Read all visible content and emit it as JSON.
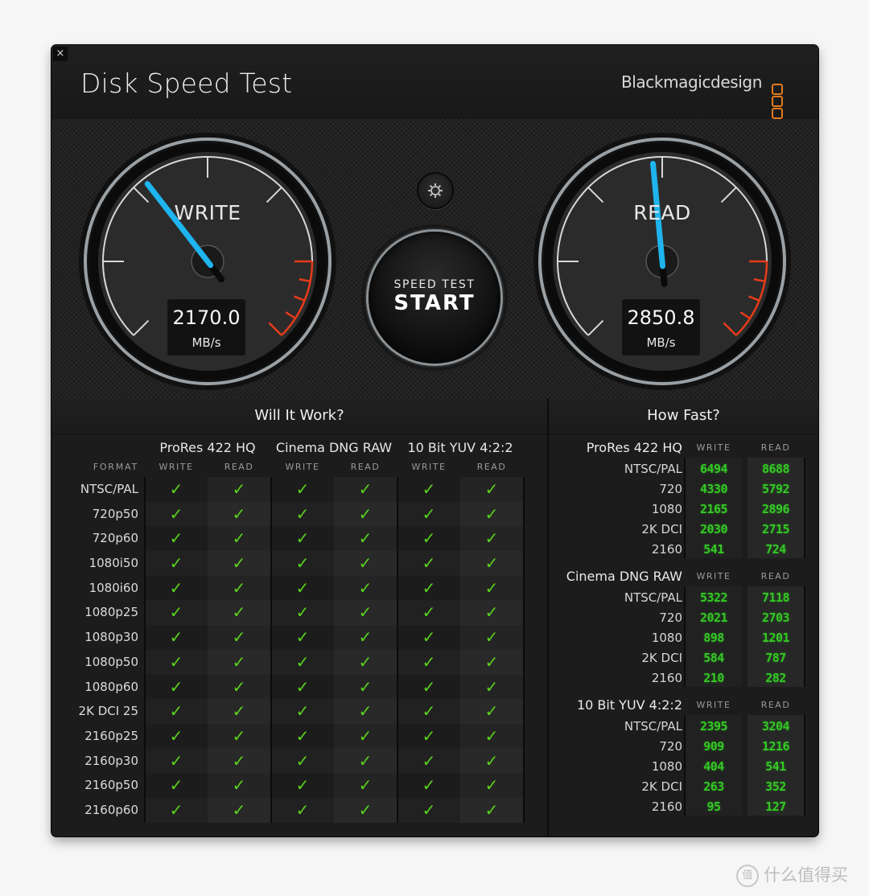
{
  "window": {
    "title": "Disk Speed Test",
    "brand": "Blackmagicdesign",
    "close_icon": "close-icon"
  },
  "colors": {
    "needle": "#1eb4ee",
    "redline": "#e63b1a",
    "check": "#5ad21e",
    "fast_value": "#35c825",
    "brand_logo": "#e07a1c"
  },
  "gauges": {
    "write": {
      "label": "WRITE",
      "value": "2170.0",
      "unit": "MB/s",
      "needle_fraction": 0.36
    },
    "read": {
      "label": "READ",
      "value": "2850.8",
      "unit": "MB/s",
      "needle_fraction": 0.48
    }
  },
  "controls": {
    "settings_icon": "gear-icon",
    "start_sub": "SPEED TEST",
    "start_main": "START"
  },
  "will_it_work": {
    "title": "Will It Work?",
    "format_header": "FORMAT",
    "codecs": [
      "ProRes 422 HQ",
      "Cinema DNG RAW",
      "10 Bit YUV 4:2:2"
    ],
    "col_write": "WRITE",
    "col_read": "READ",
    "check_glyph": "✓",
    "rows": [
      {
        "format": "NTSC/PAL",
        "ok": [
          true,
          true,
          true,
          true,
          true,
          true
        ]
      },
      {
        "format": "720p50",
        "ok": [
          true,
          true,
          true,
          true,
          true,
          true
        ]
      },
      {
        "format": "720p60",
        "ok": [
          true,
          true,
          true,
          true,
          true,
          true
        ]
      },
      {
        "format": "1080i50",
        "ok": [
          true,
          true,
          true,
          true,
          true,
          true
        ]
      },
      {
        "format": "1080i60",
        "ok": [
          true,
          true,
          true,
          true,
          true,
          true
        ]
      },
      {
        "format": "1080p25",
        "ok": [
          true,
          true,
          true,
          true,
          true,
          true
        ]
      },
      {
        "format": "1080p30",
        "ok": [
          true,
          true,
          true,
          true,
          true,
          true
        ]
      },
      {
        "format": "1080p50",
        "ok": [
          true,
          true,
          true,
          true,
          true,
          true
        ]
      },
      {
        "format": "1080p60",
        "ok": [
          true,
          true,
          true,
          true,
          true,
          true
        ]
      },
      {
        "format": "2K DCI 25",
        "ok": [
          true,
          true,
          true,
          true,
          true,
          true
        ]
      },
      {
        "format": "2160p25",
        "ok": [
          true,
          true,
          true,
          true,
          true,
          true
        ]
      },
      {
        "format": "2160p30",
        "ok": [
          true,
          true,
          true,
          true,
          true,
          true
        ]
      },
      {
        "format": "2160p50",
        "ok": [
          true,
          true,
          true,
          true,
          true,
          true
        ]
      },
      {
        "format": "2160p60",
        "ok": [
          true,
          true,
          true,
          true,
          true,
          true
        ]
      }
    ]
  },
  "how_fast": {
    "title": "How Fast?",
    "col_write": "WRITE",
    "col_read": "READ",
    "blocks": [
      {
        "codec": "ProRes 422 HQ",
        "rows": [
          {
            "format": "NTSC/PAL",
            "write": "6494",
            "read": "8688"
          },
          {
            "format": "720",
            "write": "4330",
            "read": "5792"
          },
          {
            "format": "1080",
            "write": "2165",
            "read": "2896"
          },
          {
            "format": "2K DCI",
            "write": "2030",
            "read": "2715"
          },
          {
            "format": "2160",
            "write": "541",
            "read": "724"
          }
        ]
      },
      {
        "codec": "Cinema DNG RAW",
        "rows": [
          {
            "format": "NTSC/PAL",
            "write": "5322",
            "read": "7118"
          },
          {
            "format": "720",
            "write": "2021",
            "read": "2703"
          },
          {
            "format": "1080",
            "write": "898",
            "read": "1201"
          },
          {
            "format": "2K DCI",
            "write": "584",
            "read": "787"
          },
          {
            "format": "2160",
            "write": "210",
            "read": "282"
          }
        ]
      },
      {
        "codec": "10 Bit YUV 4:2:2",
        "rows": [
          {
            "format": "NTSC/PAL",
            "write": "2395",
            "read": "3204"
          },
          {
            "format": "720",
            "write": "909",
            "read": "1216"
          },
          {
            "format": "1080",
            "write": "404",
            "read": "541"
          },
          {
            "format": "2K DCI",
            "write": "263",
            "read": "352"
          },
          {
            "format": "2160",
            "write": "95",
            "read": "127"
          }
        ]
      }
    ]
  },
  "watermark": {
    "badge": "值",
    "text": "什么值得买"
  }
}
